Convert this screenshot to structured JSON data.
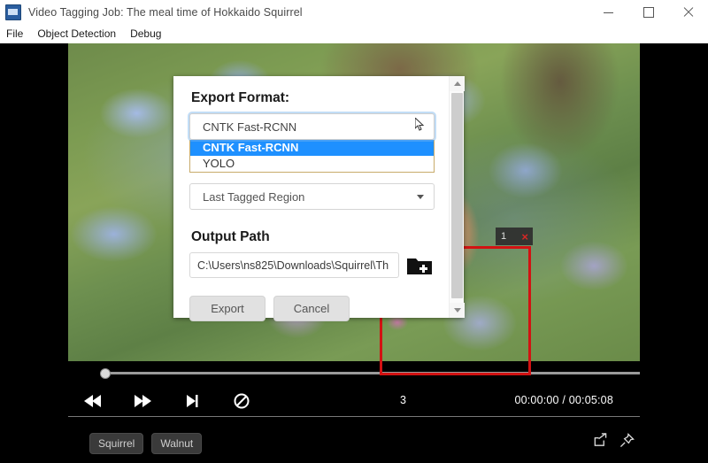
{
  "window": {
    "title": "Video Tagging Job: The meal time of Hokkaido Squirrel",
    "app_icon": "video-tagging-app-icon",
    "minimize_label": "–",
    "maximize_label": "□",
    "close_label": "×"
  },
  "menu": {
    "items": [
      {
        "label": "File"
      },
      {
        "label": "Object Detection"
      },
      {
        "label": "Debug"
      }
    ]
  },
  "dialog": {
    "export_format_label": "Export Format:",
    "format_select": {
      "value": "CNTK Fast-RCNN",
      "open": true,
      "options": [
        {
          "label": "CNTK Fast-RCNN",
          "selected": true
        },
        {
          "label": "YOLO",
          "selected": false
        }
      ],
      "highlight_color": "#1e90ff",
      "highlight_text_color": "#ffffff"
    },
    "region_select": {
      "value": "Last Tagged Region",
      "caret_icon": "chevron-down-icon"
    },
    "output_path_label": "Output Path",
    "output_path": {
      "value": "C:\\Users\\ns825\\Downloads\\Squirrel\\Th",
      "placeholder": "Output Path"
    },
    "browse_icon": "folder-add-icon",
    "export_button": "Export",
    "cancel_button": "Cancel",
    "scrollbar": {
      "up_icon": "scroll-up-arrow-icon",
      "down_icon": "scroll-down-arrow-icon"
    }
  },
  "video": {
    "region": {
      "number": "1",
      "close_label": "×",
      "box_color": "#d21212"
    }
  },
  "controls": {
    "buttons": [
      {
        "name": "rewind-button",
        "icon": "rewind-icon"
      },
      {
        "name": "fast-forward-button",
        "icon": "fast-forward-icon"
      },
      {
        "name": "skip-to-end-button",
        "icon": "skip-end-icon"
      },
      {
        "name": "disable-button",
        "icon": "no-entry-icon"
      }
    ],
    "frame_number": "3",
    "time_display": "00:00:00 / 00:05:08"
  },
  "tags": {
    "chips": [
      {
        "label": "Squirrel"
      },
      {
        "label": "Walnut"
      }
    ],
    "actions": [
      {
        "name": "export-share-button",
        "icon": "share-export-icon"
      },
      {
        "name": "pin-button",
        "icon": "pin-icon"
      }
    ]
  }
}
